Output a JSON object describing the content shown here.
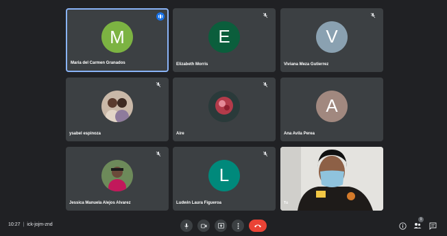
{
  "participants": [
    {
      "name": "Maria del Carmen Granados",
      "initial": "M",
      "color": "#7cb342",
      "muted": false,
      "speaking": true
    },
    {
      "name": "Elizabeth Morris",
      "initial": "E",
      "color": "#0b5e3c",
      "muted": true
    },
    {
      "name": "Viviana Meza Gutierrez",
      "initial": "V",
      "color": "#8aa1b1",
      "muted": true
    },
    {
      "name": "ysabel espinoza",
      "photo": "photo-of-two-people",
      "muted": true
    },
    {
      "name": "Aire",
      "photo": "red-flower-image",
      "muted": true
    },
    {
      "name": "Ana Avila Perea",
      "initial": "A",
      "color": "#a1887f",
      "muted": false
    },
    {
      "name": "Jessica Manuela Alejos Alvarez",
      "photo": "photo-of-woman",
      "muted": true
    },
    {
      "name": "Ludwin Laura Figueroa",
      "initial": "L",
      "color": "#00897b",
      "muted": true
    },
    {
      "name": "Tú",
      "video": "self-view-camera",
      "muted": false
    }
  ],
  "bottom_bar": {
    "time": "10:27",
    "meeting_code": "ick-jojm-znd",
    "people_count": "9"
  },
  "colors": {
    "background": "#202124",
    "tile": "#3c4043",
    "active_border": "#8ab4f8",
    "end_call": "#ea4335"
  }
}
